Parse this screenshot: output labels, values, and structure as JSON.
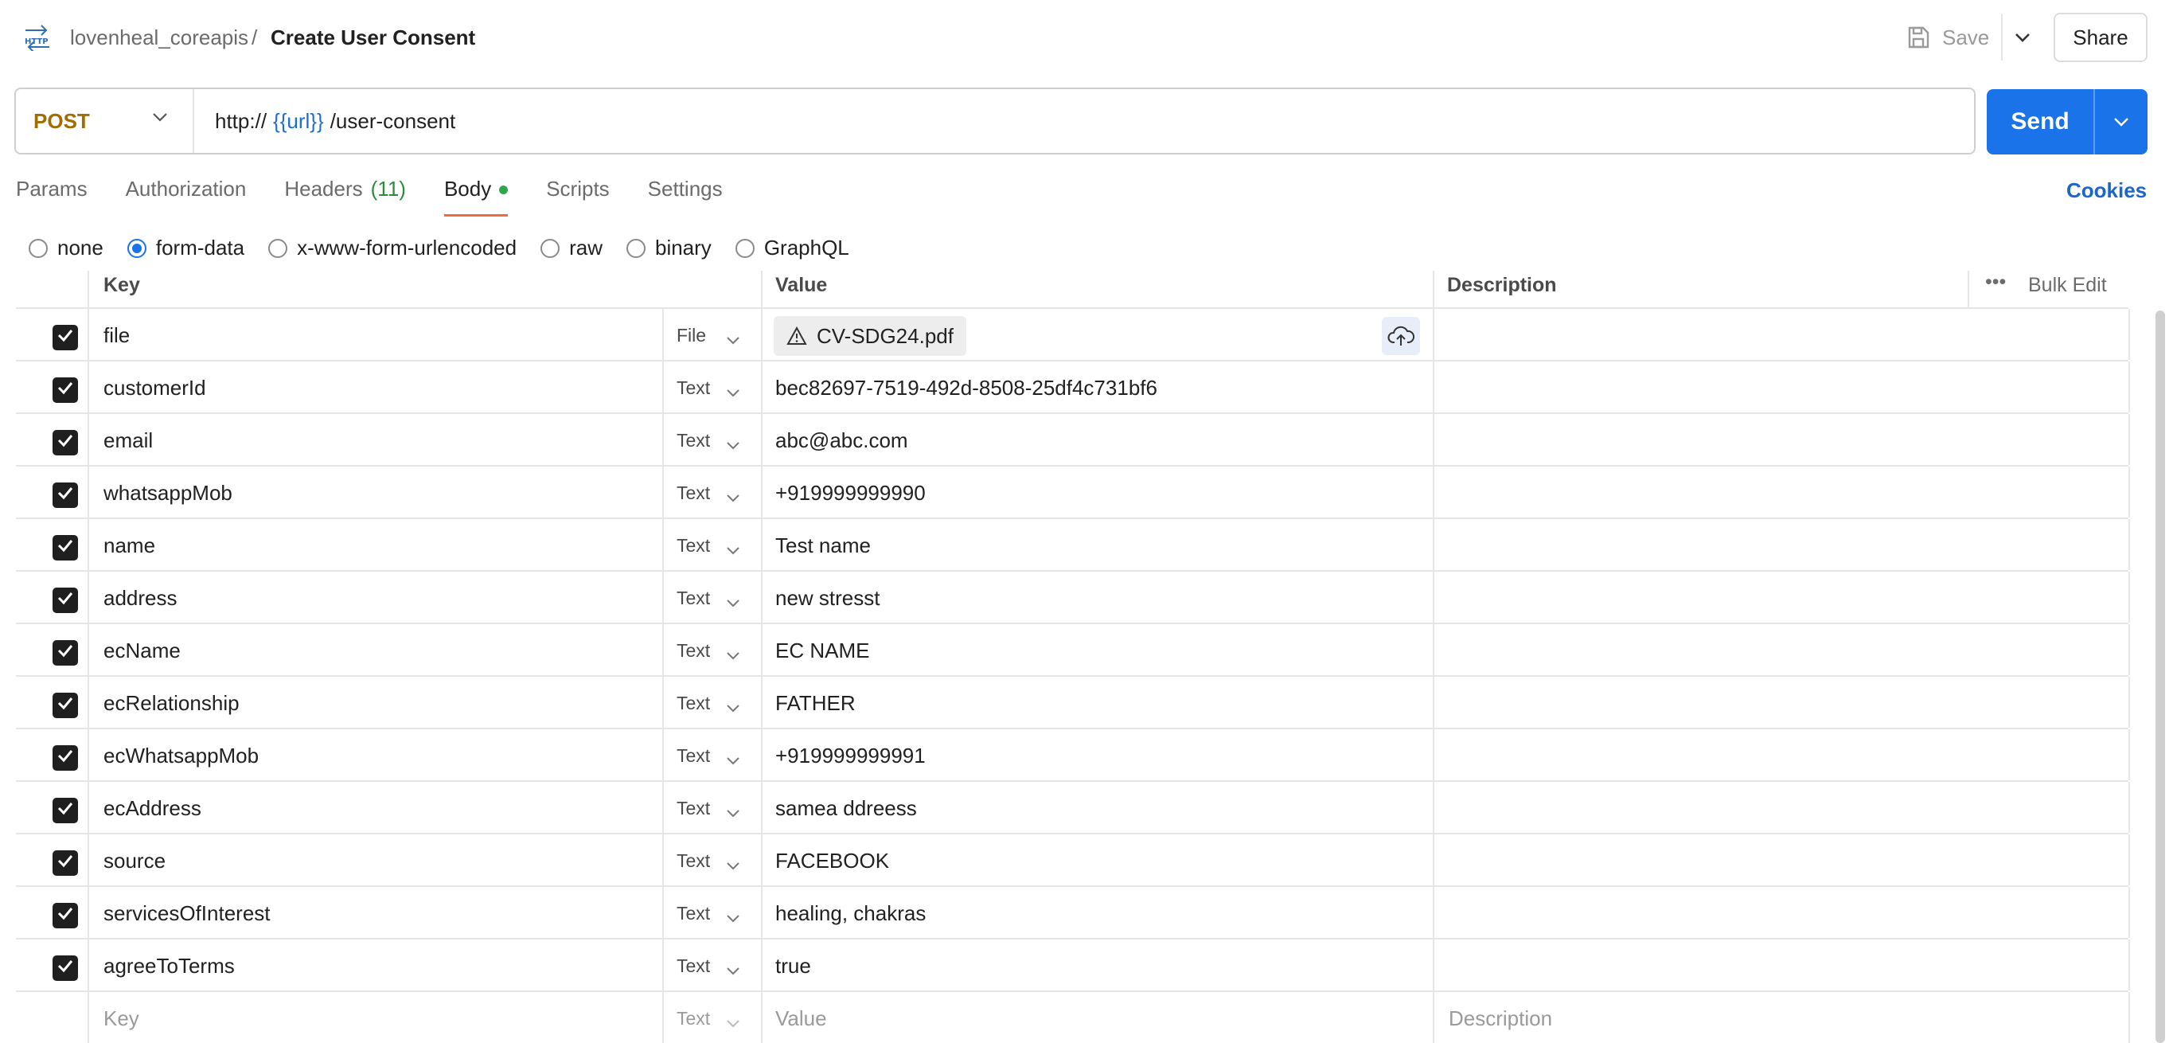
{
  "header": {
    "collection": "lovenheal_coreapis",
    "separator": "/",
    "title": "Create User Consent",
    "save_label": "Save",
    "share_label": "Share"
  },
  "request": {
    "method": "POST",
    "url_prefix": "http://",
    "url_var": "{{url}}",
    "url_suffix": "/user-consent",
    "send_label": "Send"
  },
  "tabs": [
    {
      "label": "Params"
    },
    {
      "label": "Authorization"
    },
    {
      "label": "Headers",
      "count": "(11)"
    },
    {
      "label": "Body",
      "active": true
    },
    {
      "label": "Scripts"
    },
    {
      "label": "Settings"
    }
  ],
  "cookies_label": "Cookies",
  "body_types": [
    {
      "label": "none",
      "selected": false
    },
    {
      "label": "form-data",
      "selected": true
    },
    {
      "label": "x-www-form-urlencoded",
      "selected": false
    },
    {
      "label": "raw",
      "selected": false
    },
    {
      "label": "binary",
      "selected": false
    },
    {
      "label": "GraphQL",
      "selected": false
    }
  ],
  "table": {
    "headers": {
      "key": "Key",
      "value": "Value",
      "description": "Description",
      "more": "•••",
      "bulk_edit": "Bulk Edit"
    },
    "rows": [
      {
        "key": "file",
        "type": "File",
        "value": "CV-SDG24.pdf",
        "checked": true
      },
      {
        "key": "customerId",
        "type": "Text",
        "value": "bec82697-7519-492d-8508-25df4c731bf6",
        "checked": true
      },
      {
        "key": "email",
        "type": "Text",
        "value": "abc@abc.com",
        "checked": true
      },
      {
        "key": "whatsappMob",
        "type": "Text",
        "value": "+919999999990",
        "checked": true
      },
      {
        "key": "name",
        "type": "Text",
        "value": "Test name",
        "checked": true
      },
      {
        "key": "address",
        "type": "Text",
        "value": "new stresst",
        "checked": true
      },
      {
        "key": "ecName",
        "type": "Text",
        "value": "EC NAME",
        "checked": true
      },
      {
        "key": "ecRelationship",
        "type": "Text",
        "value": "FATHER",
        "checked": true
      },
      {
        "key": "ecWhatsappMob",
        "type": "Text",
        "value": "+919999999991",
        "checked": true
      },
      {
        "key": "ecAddress",
        "type": "Text",
        "value": "samea ddreess",
        "checked": true
      },
      {
        "key": "source",
        "type": "Text",
        "value": "FACEBOOK",
        "checked": true
      },
      {
        "key": "servicesOfInterest",
        "type": "Text",
        "value": "healing, chakras",
        "checked": true
      },
      {
        "key": "agreeToTerms",
        "type": "Text",
        "value": "true",
        "checked": true
      }
    ],
    "placeholder_row": {
      "key": "Key",
      "type": "Text",
      "value": "Value",
      "description": "Description"
    }
  },
  "colors": {
    "accent": "#1a73e8",
    "method": "#a16c00",
    "tab_underline": "#f26b3a",
    "variable": "#1c6fd1"
  }
}
